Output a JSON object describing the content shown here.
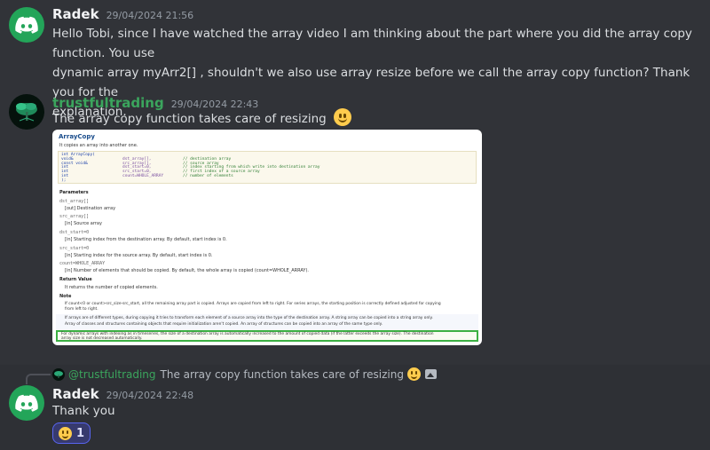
{
  "messages": [
    {
      "author": "Radek",
      "timestamp": "29/04/2024 21:56",
      "lines": [
        "Hello Tobi, since I have watched the array video I am thinking about the part where you did the array copy function. You use",
        "dynamic array myArr2[] , shouldn't we also use array resize before we call the array copy function? Thank you for the",
        "explanation."
      ]
    },
    {
      "author": "trustfultrading",
      "timestamp": "29/04/2024 22:43",
      "text": "The array copy function takes care of resizing"
    },
    {
      "author": "Radek",
      "timestamp": "29/04/2024 22:48",
      "text": "Thank you"
    }
  ],
  "reply_preview": {
    "mention": "@trustfultrading",
    "text": "The array copy function takes care of resizing"
  },
  "reaction": {
    "emoji": "slightly-smiling-face",
    "count": "1"
  },
  "doc_image": {
    "title": "ArrayCopy",
    "subtitle": "It copies an array into another one.",
    "code_lines": [
      [
        "int  ArrayCopy(",
        "",
        ""
      ],
      [
        "   void&",
        "dst_array[],",
        "// destination array"
      ],
      [
        "   const void&",
        "src_array[],",
        "// source array"
      ],
      [
        "   int",
        "dst_start=0,",
        "// index starting from which write into destination array"
      ],
      [
        "   int",
        "src_start=0,",
        "// first index of a source array"
      ],
      [
        "   int",
        "count=WHOLE_ARRAY",
        "// number of elements"
      ],
      [
        "   );",
        "",
        ""
      ]
    ],
    "params_heading": "Parameters",
    "params": [
      {
        "name": "dst_array[]",
        "desc": "[out]  Destination array"
      },
      {
        "name": "src_array[]",
        "desc": "[in]  Source array"
      },
      {
        "name": "dst_start=0",
        "desc": "[in]  Starting index from the destination array. By default, start index is 0."
      },
      {
        "name": "src_start=0",
        "desc": "[in]  Starting index for the source array. By default, start index is 0."
      },
      {
        "name": "count=WHOLE_ARRAY",
        "desc": "[in]  Number of elements that should be copied. By default, the whole array is copied (count=WHOLE_ARRAY)."
      }
    ],
    "return_heading": "Return Value",
    "return_text": "It returns the number of copied elements.",
    "note_heading": "Note",
    "notes": [
      "If count<0 or count>src_size-src_start, all the remaining array part is copied. Arrays are copied from left to right. For series arrays, the starting position is correctly defined adjusted for copying",
      "from left to right.",
      "If arrays are of different types, during copying it tries to transform each element of a source array into the type of the destination array. A string array can be copied into a string array only.",
      "Array of classes and structures containing objects that require initialization aren't copied. An array of structures can be copied into an array of the same type only.",
      "For dynamic arrays with indexing as in timeseries, the size of a destination array is automatically increased to the amount of copied data (if the latter exceeds the array size). The destination",
      "array size is not decreased automatically."
    ]
  },
  "colors": {
    "background": "#313338",
    "username": "#f2f3f5",
    "username_green": "#3ba55d",
    "timestamp": "#949ba4",
    "highlight_border": "#3cb043",
    "reaction_border": "#5865f2"
  }
}
